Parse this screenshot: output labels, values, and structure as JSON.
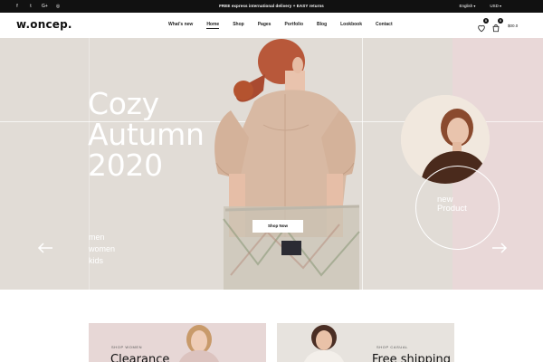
{
  "topbar": {
    "social_icons": [
      "facebook-icon",
      "twitter-icon",
      "google-plus-icon",
      "instagram-icon"
    ],
    "social_glyphs": [
      "f",
      "t",
      "G+",
      "◎"
    ],
    "promo": "FREE express international delivery + EASY returns",
    "language": "English",
    "currency": "USD"
  },
  "header": {
    "logo": "w.oncep.",
    "nav": [
      {
        "label": "What's new",
        "active": false
      },
      {
        "label": "Home",
        "active": true
      },
      {
        "label": "Shop",
        "active": false
      },
      {
        "label": "Pages",
        "active": false
      },
      {
        "label": "Portfolio",
        "active": false
      },
      {
        "label": "Blog",
        "active": false
      },
      {
        "label": "Lookbook",
        "active": false
      },
      {
        "label": "Contact",
        "active": false
      }
    ],
    "wishlist_count": "0",
    "cart_count": "0",
    "cart_total": "$00.0"
  },
  "hero": {
    "title_line1": "Cozy",
    "title_line2": "Autumn",
    "title_line3": "2020",
    "categories": [
      "men",
      "women",
      "kids"
    ],
    "cta": "Shop Now",
    "new_product_line1": "new",
    "new_product_line2": "Product",
    "colors": {
      "background": "#e1dcd6",
      "panel": "#e9d8d8",
      "blouse": "#d8b9a3",
      "hair": "#b8583a"
    }
  },
  "promos": [
    {
      "kicker": "SHOP WOMEN",
      "headline": "Clearance"
    },
    {
      "kicker": "SHOP CASUAL",
      "headline": "Free shipping"
    }
  ]
}
